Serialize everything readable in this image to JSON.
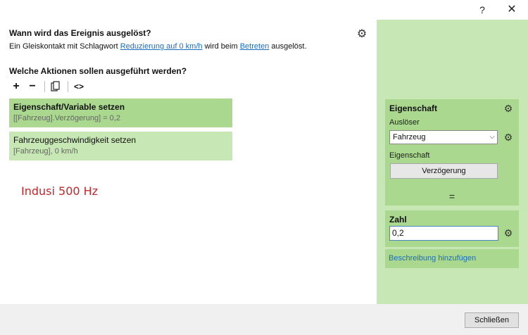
{
  "window": {
    "help_label": "?",
    "close_label": "✕"
  },
  "trigger": {
    "heading": "Wann wird das Ereignis ausgelöst?",
    "desc_prefix": "Ein Gleiskontakt mit Schlagwort ",
    "desc_link1": "Reduzierung auf 0 km/h",
    "desc_middle": " wird beim ",
    "desc_link2": "Betreten",
    "desc_suffix": " ausgelöst.",
    "settings_icon": "gear-icon"
  },
  "actions": {
    "heading": "Welche Aktionen sollen ausgeführt werden?",
    "toolbar": {
      "add": "+",
      "remove": "−",
      "code": "<>"
    },
    "items": [
      {
        "title": "Eigenschaft/Variable setzen",
        "subtitle": "[[Fahrzeug].Verzögerung] = 0,2"
      },
      {
        "title": "Fahrzeuggeschwindigkeit setzen",
        "subtitle": "[Fahrzeug], 0 km/h"
      }
    ]
  },
  "annotation": "Indusi 500 Hz",
  "panel": {
    "property": {
      "title": "Eigenschaft",
      "trigger_label": "Auslöser",
      "trigger_value": "Fahrzeug",
      "property_label": "Eigenschaft",
      "property_value": "Verzögerung"
    },
    "equals": "=",
    "number": {
      "title": "Zahl",
      "value": "0,2"
    },
    "add_description": "Beschreibung hinzufügen"
  },
  "footer": {
    "close_label": "Schließen"
  },
  "colors": {
    "panel_bg": "#c7e7b4",
    "box_bg": "#a9d88e",
    "link": "#1a6ec0",
    "annotation": "#c0282a"
  }
}
